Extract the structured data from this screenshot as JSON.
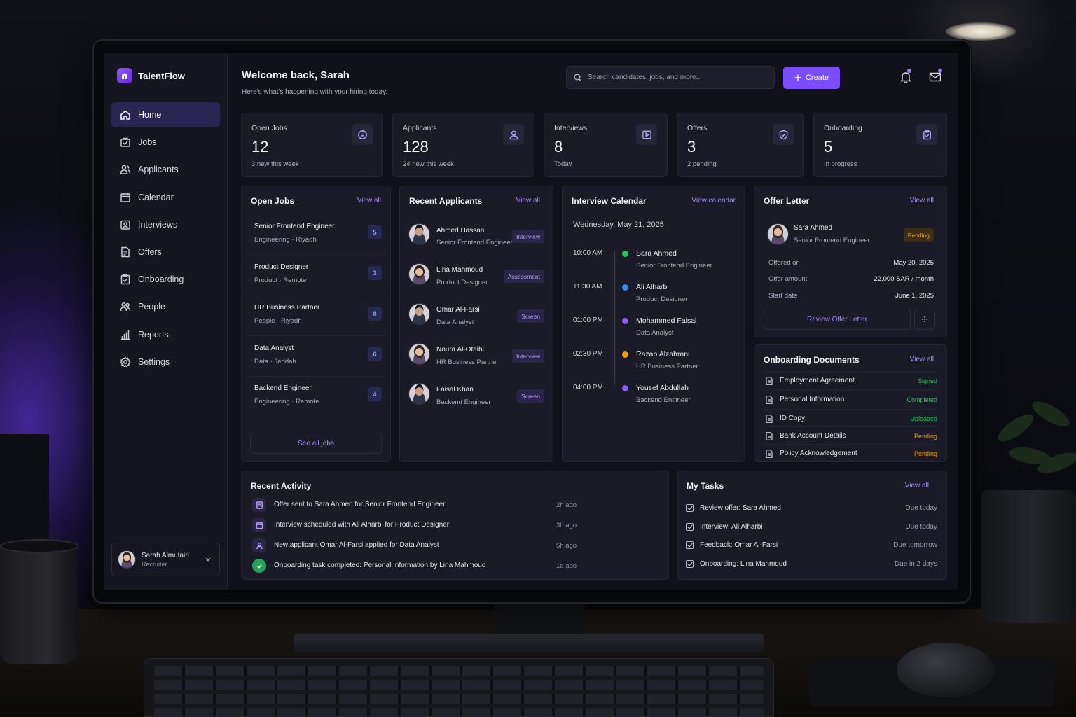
{
  "app": {
    "name": "TalentFlow"
  },
  "sidebar": {
    "items": [
      {
        "label": "Home",
        "icon": "home-icon"
      },
      {
        "label": "Jobs",
        "icon": "briefcase-icon"
      },
      {
        "label": "Applicants",
        "icon": "users-icon"
      },
      {
        "label": "Calendar",
        "icon": "calendar-icon"
      },
      {
        "label": "Interviews",
        "icon": "interview-icon"
      },
      {
        "label": "Offers",
        "icon": "document-icon"
      },
      {
        "label": "Onboarding",
        "icon": "clipboard-icon"
      },
      {
        "label": "People",
        "icon": "people-icon"
      },
      {
        "label": "Reports",
        "icon": "bar-chart-icon"
      },
      {
        "label": "Settings",
        "icon": "gear-icon"
      }
    ],
    "active": "Home",
    "user": {
      "name": "Sarah Almutairi",
      "role": "Recruiter"
    }
  },
  "header": {
    "title": "Welcome back, Sarah",
    "subtitle": "Here's what's happening with your hiring today.",
    "search_placeholder": "Search candidates, jobs, and more...",
    "create_label": "Create"
  },
  "stats": [
    {
      "label": "Open Jobs",
      "value": "12",
      "sub": "3 new this week"
    },
    {
      "label": "Applicants",
      "value": "128",
      "sub": "24 new this week"
    },
    {
      "label": "Interviews",
      "value": "8",
      "sub": "Today"
    },
    {
      "label": "Offers",
      "value": "3",
      "sub": "2 pending"
    },
    {
      "label": "Onboarding",
      "value": "5",
      "sub": "In progress"
    }
  ],
  "open_jobs": {
    "title": "Open Jobs",
    "view_all": "View all",
    "see_all": "See all jobs",
    "rows": [
      {
        "title": "Senior Frontend Engineer",
        "dept": "Engineering",
        "location": "Riyadh",
        "count": "5"
      },
      {
        "title": "Product Designer",
        "dept": "Product",
        "location": "Remote",
        "count": "3"
      },
      {
        "title": "HR Business Partner",
        "dept": "People",
        "location": "Riyadh",
        "count": "8"
      },
      {
        "title": "Data Analyst",
        "dept": "Data",
        "location": "Jeddah",
        "count": "6"
      },
      {
        "title": "Backend Engineer",
        "dept": "Engineering",
        "location": "Remote",
        "count": "4"
      }
    ]
  },
  "recent_applicants": {
    "title": "Recent Applicants",
    "view_all": "View all",
    "rows": [
      {
        "name": "Ahmed Hassan",
        "role": "Senior Frontend Engineer",
        "stage": "Interview"
      },
      {
        "name": "Lina Mahmoud",
        "role": "Product Designer",
        "stage": "Assessment"
      },
      {
        "name": "Omar Al-Farsi",
        "role": "Data Analyst",
        "stage": "Screen"
      },
      {
        "name": "Noura Al-Otaibi",
        "role": "HR Business Partner",
        "stage": "Interview"
      },
      {
        "name": "Faisal Khan",
        "role": "Backend Engineer",
        "stage": "Screen"
      }
    ]
  },
  "interview_calendar": {
    "title": "Interview Calendar",
    "view_all": "View calendar",
    "date": "Wednesday, May 21, 2025",
    "rows": [
      {
        "time": "10:00 AM",
        "name": "Sara Ahmed",
        "role": "Senior Frontend Engineer",
        "color": "#22c55e"
      },
      {
        "time": "11:30 AM",
        "name": "Ali Alharbi",
        "role": "Product Designer",
        "color": "#3b82f6"
      },
      {
        "time": "01:00 PM",
        "name": "Mohammed Faisal",
        "role": "Data Analyst",
        "color": "#8b5cf6"
      },
      {
        "time": "02:30 PM",
        "name": "Razan Alzahrani",
        "role": "HR Business Partner",
        "color": "#f59e0b"
      },
      {
        "time": "04:00 PM",
        "name": "Yousef Abdullah",
        "role": "Backend Engineer",
        "color": "#8b5cf6"
      }
    ]
  },
  "offer_letter": {
    "title": "Offer Letter",
    "view_all": "View all",
    "name": "Sara Ahmed",
    "role": "Senior Frontend Engineer",
    "status": "Pending",
    "offered_on_label": "Offered on",
    "offered_on": "May 20, 2025",
    "amount_label": "Offer amount",
    "amount": "22,000 SAR / month",
    "start_label": "Start date",
    "start": "June 1, 2025",
    "review_label": "Review Offer Letter"
  },
  "onboarding_docs": {
    "title": "Onboarding Documents",
    "view_all": "View all",
    "rows": [
      {
        "name": "Employment Agreement",
        "status": "Signed",
        "color": "#22c55e"
      },
      {
        "name": "Personal Information",
        "status": "Completed",
        "color": "#22c55e"
      },
      {
        "name": "ID Copy",
        "status": "Uploaded",
        "color": "#22c55e"
      },
      {
        "name": "Bank Account Details",
        "status": "Pending",
        "color": "#f59e0b"
      },
      {
        "name": "Policy Acknowledgement",
        "status": "Pending",
        "color": "#f59e0b"
      }
    ]
  },
  "recent_activity": {
    "title": "Recent Activity",
    "rows": [
      {
        "text": "Offer sent to Sara Ahmed for Senior Frontend Engineer",
        "time": "2h ago",
        "icon": "offer-icon"
      },
      {
        "text": "Interview scheduled with Ali Alharbi for Product Designer",
        "time": "3h ago",
        "icon": "calendar-icon"
      },
      {
        "text": "New applicant Omar Al-Farsi applied for Data Analyst",
        "time": "5h ago",
        "icon": "user-icon"
      },
      {
        "text": "Onboarding task completed:  Personal Information by Lina Mahmoud",
        "time": "1d ago",
        "icon": "check-circle-icon"
      }
    ]
  },
  "my_tasks": {
    "title": "My Tasks",
    "view_all": "View all",
    "rows": [
      {
        "text": "Review offer:  Sara Ahmed",
        "due": "Due today"
      },
      {
        "text": "Interview:  Ali Alharbi",
        "due": "Due today"
      },
      {
        "text": "Feedback:  Omar Al-Farsi",
        "due": "Due tomorrow"
      },
      {
        "text": "Onboarding:  Lina Mahmoud",
        "due": "Due in 2 days"
      }
    ]
  },
  "colors": {
    "accent": "#7c4dff",
    "link": "#a78bfa",
    "success": "#22c55e",
    "warning": "#f59e0b"
  }
}
